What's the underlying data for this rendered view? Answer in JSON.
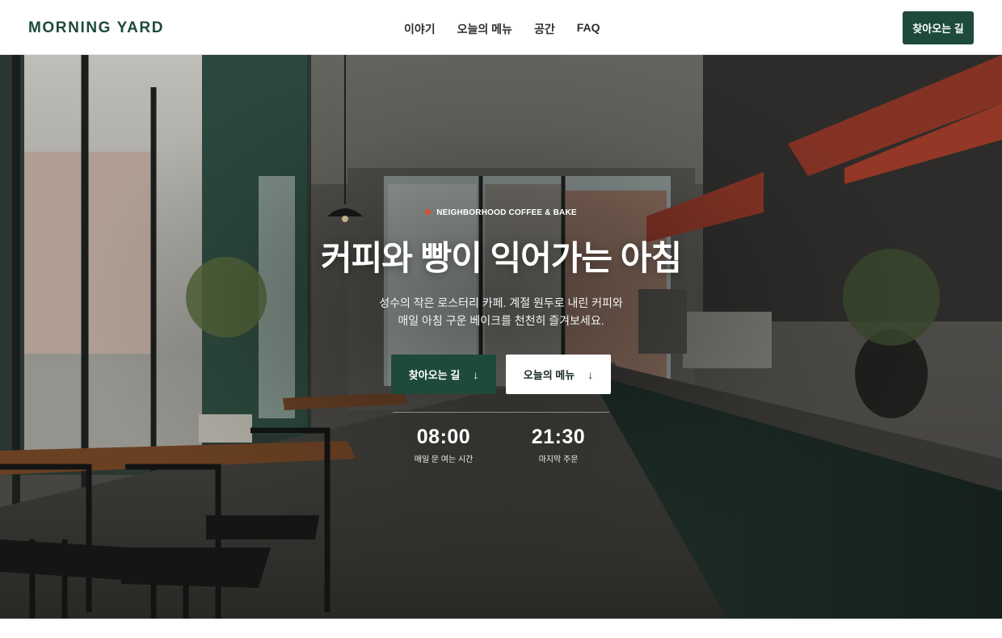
{
  "header": {
    "brand": "MORNING YARD",
    "nav": [
      "이야기",
      "오늘의 메뉴",
      "공간",
      "FAQ"
    ],
    "cta_label": "찾아오는 길"
  },
  "hero": {
    "eyebrow": "NEIGHBORHOOD COFFEE & BAKE",
    "title": "커피와 빵이 익어가는 아침",
    "description_line1": "성수의 작은 로스터리 카페. 계절 원두로 내린 커피와",
    "description_line2": "매일 아침 구운 베이크를 천천히 즐겨보세요.",
    "primary_button": "찾아오는 길",
    "secondary_button": "오늘의 메뉴",
    "arrow_icon": "arrow-down-icon",
    "stats": [
      {
        "value": "08:00",
        "label": "매일 문 여는 시간"
      },
      {
        "value": "21:30",
        "label": "마지막 주문"
      }
    ]
  },
  "colors": {
    "brand_green": "#1d4a3b",
    "accent_dot": "#d9502c",
    "white": "#ffffff"
  }
}
